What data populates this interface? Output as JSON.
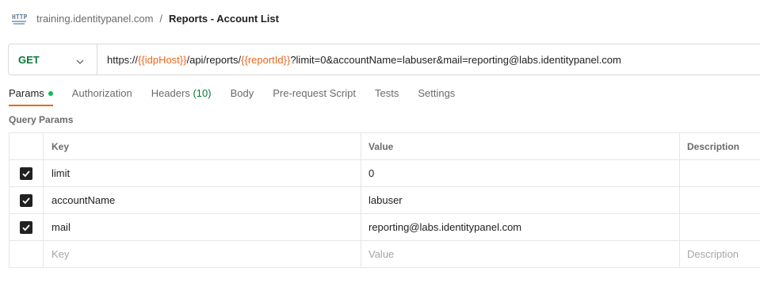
{
  "breadcrumb": {
    "icon": "http-icon",
    "host": "training.identitypanel.com",
    "separator": "/",
    "title": "Reports - Account List"
  },
  "request": {
    "method": "GET",
    "url_parts": {
      "p1": "https://",
      "v1": "{{idpHost}}",
      "p2": "/api/reports/",
      "v2": "{{reportId}}",
      "p3": "?limit=0&accountName=labuser&mail=reporting@labs.identitypanel.com"
    }
  },
  "tabs": {
    "params": "Params",
    "authorization": "Authorization",
    "headers": "Headers",
    "headers_count": "(10)",
    "body": "Body",
    "prerequest": "Pre-request Script",
    "tests": "Tests",
    "settings": "Settings"
  },
  "query_params": {
    "title": "Query Params",
    "columns": {
      "key": "Key",
      "value": "Value",
      "description": "Description"
    },
    "rows": [
      {
        "checked": true,
        "key": "limit",
        "value": "0",
        "description": ""
      },
      {
        "checked": true,
        "key": "accountName",
        "value": "labuser",
        "description": ""
      },
      {
        "checked": true,
        "key": "mail",
        "value": "reporting@labs.identitypanel.com",
        "description": ""
      }
    ],
    "placeholders": {
      "key": "Key",
      "value": "Value",
      "description": "Description"
    }
  },
  "colors": {
    "accent": "#e8681f",
    "method": "#0b7a38",
    "dot": "#0cbb52"
  }
}
